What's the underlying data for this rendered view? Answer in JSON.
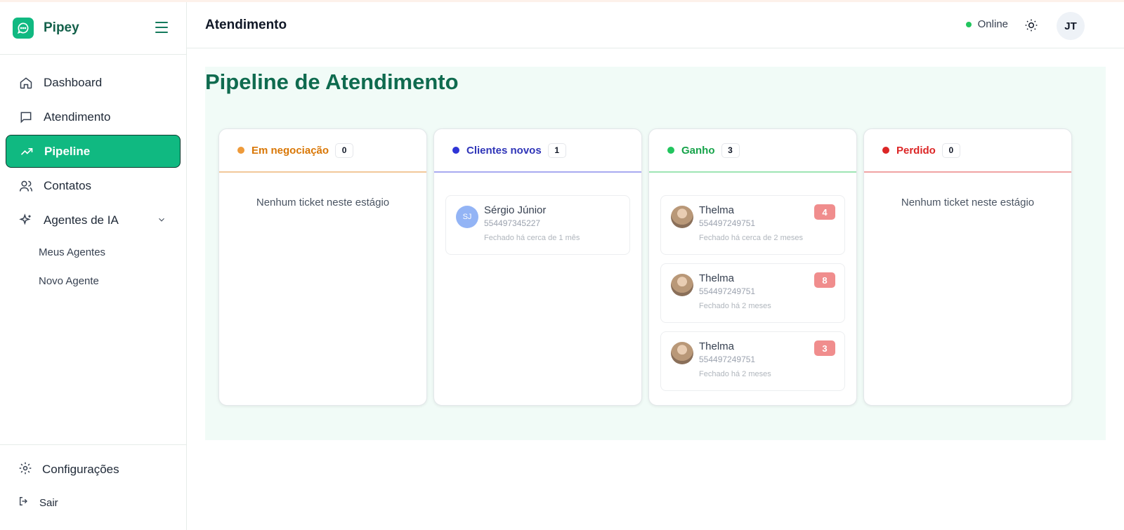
{
  "app": {
    "name": "Pipey"
  },
  "sidebar": {
    "items": [
      {
        "label": "Dashboard",
        "icon": "home-icon"
      },
      {
        "label": "Atendimento",
        "icon": "message-square-icon"
      },
      {
        "label": "Pipeline",
        "icon": "trending-up-icon",
        "active": true
      },
      {
        "label": "Contatos",
        "icon": "users-icon"
      },
      {
        "label": "Agentes de IA",
        "icon": "sparkles-icon",
        "expanded": true
      }
    ],
    "subitems": [
      {
        "label": "Meus Agentes"
      },
      {
        "label": "Novo Agente"
      }
    ],
    "bottom": [
      {
        "label": "Configurações",
        "icon": "gear-icon"
      },
      {
        "label": "Sair",
        "icon": "logout-icon"
      }
    ]
  },
  "header": {
    "title": "Atendimento",
    "status": "Online",
    "user_initials": "JT"
  },
  "main": {
    "title": "Pipeline de Atendimento",
    "empty_text": "Nenhum ticket neste estágio",
    "columns": [
      {
        "name": "Em negociação",
        "count": "0",
        "color": "#ee9a3a",
        "text_color": "#d97706",
        "line_color": "#f2c89a",
        "head_bg": "#ffffff",
        "cards": []
      },
      {
        "name": "Clientes novos",
        "count": "1",
        "color": "#2f35d6",
        "text_color": "#2f35b8",
        "line_color": "#a8aaf0",
        "head_bg": "#ffffff",
        "cards": [
          {
            "initials": "SJ",
            "name": "Sérgio Júnior",
            "phone": "554497345227",
            "time": "Fechado há cerca de 1 mês"
          }
        ]
      },
      {
        "name": "Ganho",
        "count": "3",
        "color": "#22c55e",
        "text_color": "#16a34a",
        "line_color": "#9ee5b4",
        "head_bg": "#ffffff",
        "cards": [
          {
            "name": "Thelma",
            "phone": "554497249751",
            "time": "Fechado há cerca de 2 meses",
            "badge": "4"
          },
          {
            "name": "Thelma",
            "phone": "554497249751",
            "time": "Fechado há 2 meses",
            "badge": "8"
          },
          {
            "name": "Thelma",
            "phone": "554497249751",
            "time": "Fechado há 2 meses",
            "badge": "3"
          }
        ]
      },
      {
        "name": "Perdido",
        "count": "0",
        "color": "#dc2626",
        "text_color": "#dc2626",
        "line_color": "#f0a3a3",
        "head_bg": "#ffffff",
        "cards": []
      }
    ]
  }
}
